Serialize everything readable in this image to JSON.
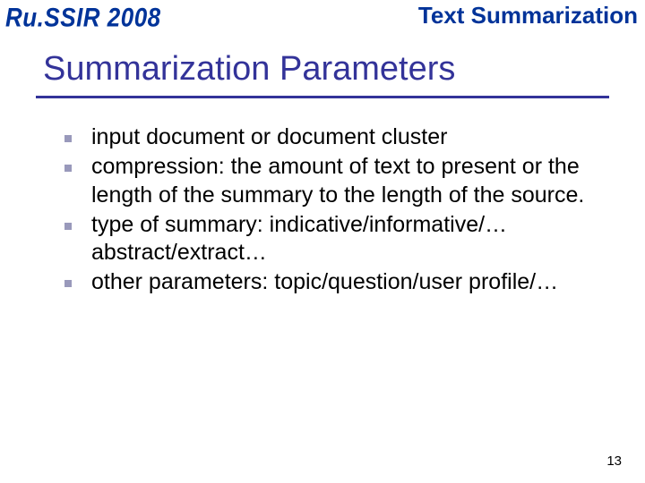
{
  "header": {
    "left": "Ru.SSIR 2008",
    "right": "Text Summarization"
  },
  "title": "Summarization Parameters",
  "bullets": [
    "input document or document cluster",
    "compression: the amount of text to present or the length of the summary to the length of the source.",
    "type of summary: indicative/informative/… abstract/extract…",
    "other parameters: topic/question/user profile/…"
  ],
  "page_number": "13"
}
